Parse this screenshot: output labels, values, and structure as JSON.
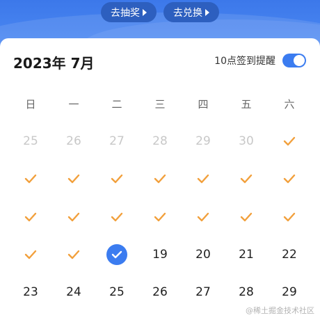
{
  "header": {
    "lottery_label": "去抽奖",
    "exchange_label": "去兑换"
  },
  "calendar": {
    "month_title": "2023年 7月",
    "reminder_label": "10点签到提醒",
    "reminder_on": true,
    "weekdays": [
      "日",
      "一",
      "二",
      "三",
      "四",
      "五",
      "六"
    ],
    "prev_month_days": [
      "25",
      "26",
      "27",
      "28",
      "29",
      "30"
    ],
    "row4_days": [
      "19",
      "20",
      "21",
      "22"
    ],
    "row5_days": [
      "23",
      "24",
      "25",
      "26",
      "27",
      "28",
      "29"
    ]
  },
  "colors": {
    "accent": "#3b7cf0",
    "check": "#f2a03c"
  },
  "watermark": "@稀土掘金技术社区"
}
